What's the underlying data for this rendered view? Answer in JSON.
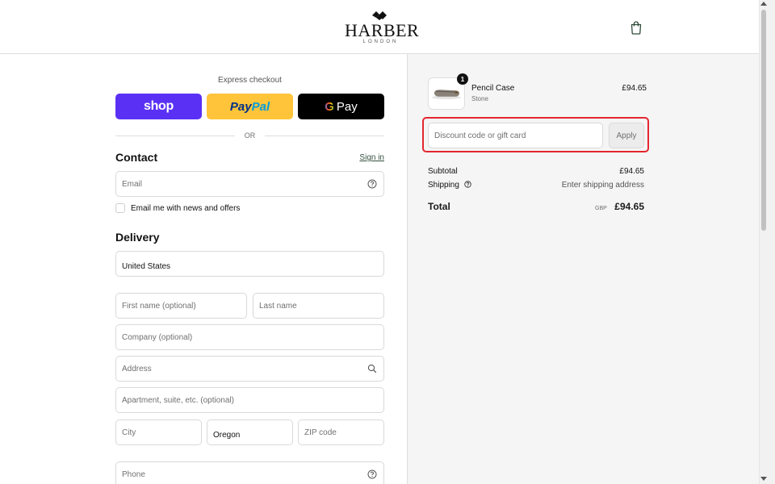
{
  "brand": {
    "name": "HARBER",
    "subtitle": "LONDON"
  },
  "express": {
    "label": "Express checkout",
    "shop_label": "shop",
    "paypal_part1": "Pay",
    "paypal_part2": "Pal",
    "gpay_g": "G",
    "gpay_label": "Pay",
    "or_label": "OR"
  },
  "contact": {
    "title": "Contact",
    "signin": "Sign in",
    "email_placeholder": "Email",
    "newsletter_label": "Email me with news and offers"
  },
  "delivery": {
    "title": "Delivery",
    "country_value": "United States",
    "first_name_placeholder": "First name (optional)",
    "last_name_placeholder": "Last name",
    "company_placeholder": "Company (optional)",
    "address_placeholder": "Address",
    "apartment_placeholder": "Apartment, suite, etc. (optional)",
    "city_placeholder": "City",
    "state_value": "Oregon",
    "zip_placeholder": "ZIP code",
    "phone_placeholder": "Phone"
  },
  "order": {
    "item": {
      "name": "Pencil Case",
      "variant": "Stone",
      "price": "£94.65",
      "quantity": "1"
    },
    "discount_placeholder": "Discount code or gift card",
    "apply_label": "Apply",
    "subtotal_label": "Subtotal",
    "subtotal_value": "£94.65",
    "shipping_label": "Shipping",
    "shipping_value": "Enter shipping address",
    "total_label": "Total",
    "total_currency": "GBP",
    "total_value": "£94.65"
  },
  "colors": {
    "shop": "#5a31f4",
    "paypal": "#ffc439",
    "gpay": "#000000",
    "highlight": "#e3262f",
    "link": "#334f3e"
  }
}
